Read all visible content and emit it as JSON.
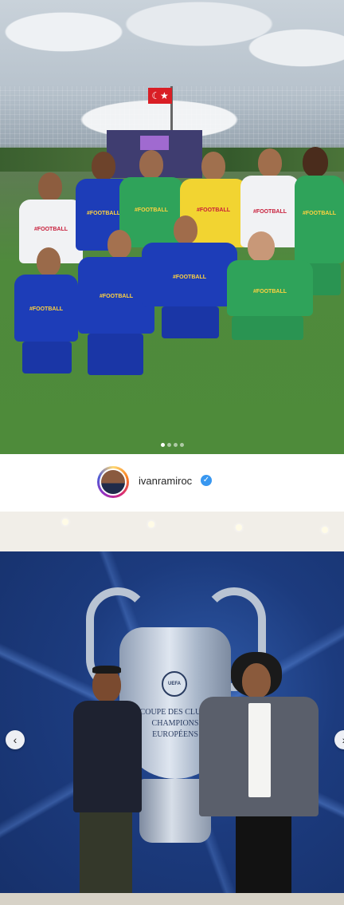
{
  "post1": {
    "carousel_dots": 4,
    "active_dot": 1,
    "jersey_text": "#FOOTBALL",
    "flag_symbol": "☾★"
  },
  "profile": {
    "username": "ivanramiroc",
    "verified": true,
    "verified_icon": "✓"
  },
  "post2": {
    "badge_text": "UEFA",
    "trophy_text_line1": "COUPE DES CLUBS CHAMPIONS",
    "trophy_text_line2": "EUROPÉENS",
    "prev_icon": "‹",
    "next_icon": "›"
  },
  "colors": {
    "verified_blue": "#3897f0",
    "kit_blue": "#1d3db8",
    "kit_green": "#2fa35a"
  }
}
